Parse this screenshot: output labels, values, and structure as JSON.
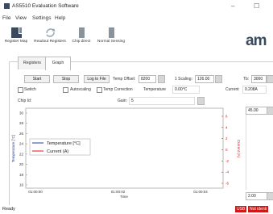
{
  "window": {
    "title": "AS5510 Evaluation Software",
    "minimize": "–",
    "maximize": "☐"
  },
  "menu": [
    "File",
    "View",
    "Settings",
    "Help"
  ],
  "toolbar": {
    "items": [
      {
        "label": "Register Map",
        "icon": "grid-icon"
      },
      {
        "label": "Readout Registers",
        "icon": "refresh-icon"
      },
      {
        "label": "Chip direct",
        "icon": "chip-icon"
      },
      {
        "label": "Normal Sensing",
        "icon": "chip-icon"
      }
    ],
    "logo": "am"
  },
  "tabs": [
    {
      "label": "Registers"
    },
    {
      "label": "Graph"
    }
  ],
  "controls": {
    "start": "Start",
    "stop": "Stop",
    "log_to_file": "Log to File",
    "temp_offset_label": "Temp Offset:",
    "temp_offset_value": "8200",
    "scaling_label": "1 Scaling:",
    "scaling_value": "126.00",
    "tb_label": "Tb:",
    "tb_value": "3000",
    "switch_label": "Switch",
    "autoscaling_label": "Autoscaling",
    "temp_correction_label": "Temp Correction",
    "temperature_label": "Temperature",
    "temperature_value": "0.00°C",
    "current_label": "Current",
    "current_value": "0.208A",
    "chip_id_label": "Chip Id:",
    "gain_label": "Gain:",
    "gain_value": "5"
  },
  "side_values": {
    "top": "45.00",
    "bottom": "2.00"
  },
  "chart_data": {
    "type": "line",
    "xlabel": "Time",
    "ylabel_left": "Temperature [°C]",
    "ylabel_right": "Current (A)",
    "y_left_ticks": [
      "30",
      "28",
      "26",
      "24",
      "22",
      "20",
      "18",
      "16"
    ],
    "y_right_ticks": [
      "6",
      "4",
      "2",
      "0",
      "-2",
      "-4",
      "-6"
    ],
    "x_ticks": [
      "01:00:00",
      "01:00:02",
      "01:00:04"
    ],
    "series": [
      {
        "name": "Temperature [°C]",
        "color": "#2a3f9f",
        "values": []
      },
      {
        "name": "Current (A)",
        "color": "#d01818",
        "values": []
      }
    ]
  },
  "status": {
    "text": "Ready",
    "badge_usb": "USB",
    "badge_status": "Not identi"
  }
}
